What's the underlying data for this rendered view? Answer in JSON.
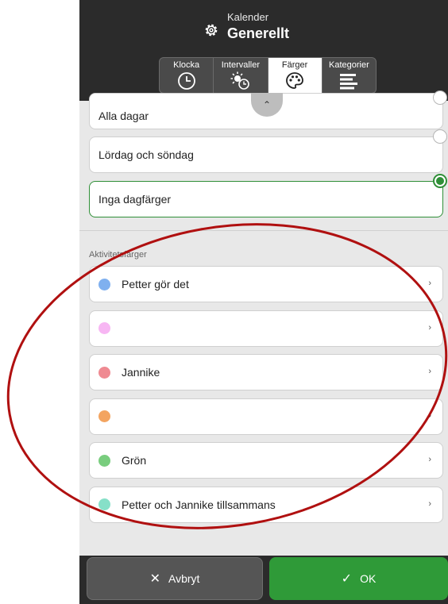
{
  "header": {
    "subtitle": "Kalender",
    "title": "Generellt"
  },
  "tabs": [
    {
      "label": "Klocka",
      "icon": "clock-icon"
    },
    {
      "label": "Intervaller",
      "icon": "sun-clock-icon"
    },
    {
      "label": "Färger",
      "icon": "palette-icon"
    },
    {
      "label": "Kategorier",
      "icon": "lines-icon"
    }
  ],
  "day_options": [
    {
      "label": "Alla dagar",
      "selected": false
    },
    {
      "label": "Lördag och söndag",
      "selected": false
    },
    {
      "label": "Inga dagfärger",
      "selected": true
    }
  ],
  "section_label": "Aktivitetsfärger",
  "activities": [
    {
      "label": "Petter gör det",
      "color": "#7fb0ef"
    },
    {
      "label": "",
      "color": "#f7b6f3"
    },
    {
      "label": "Jannike",
      "color": "#ef8a92"
    },
    {
      "label": "",
      "color": "#f3a460"
    },
    {
      "label": "Grön",
      "color": "#79cd7e"
    },
    {
      "label": "Petter och Jannike tillsammans",
      "color": "#86e0c8"
    }
  ],
  "chevron": "›",
  "buttons": {
    "cancel_label": "Avbryt",
    "ok_label": "OK"
  },
  "colors": {
    "accent": "#2f9a38",
    "annotation": "#b01010"
  }
}
